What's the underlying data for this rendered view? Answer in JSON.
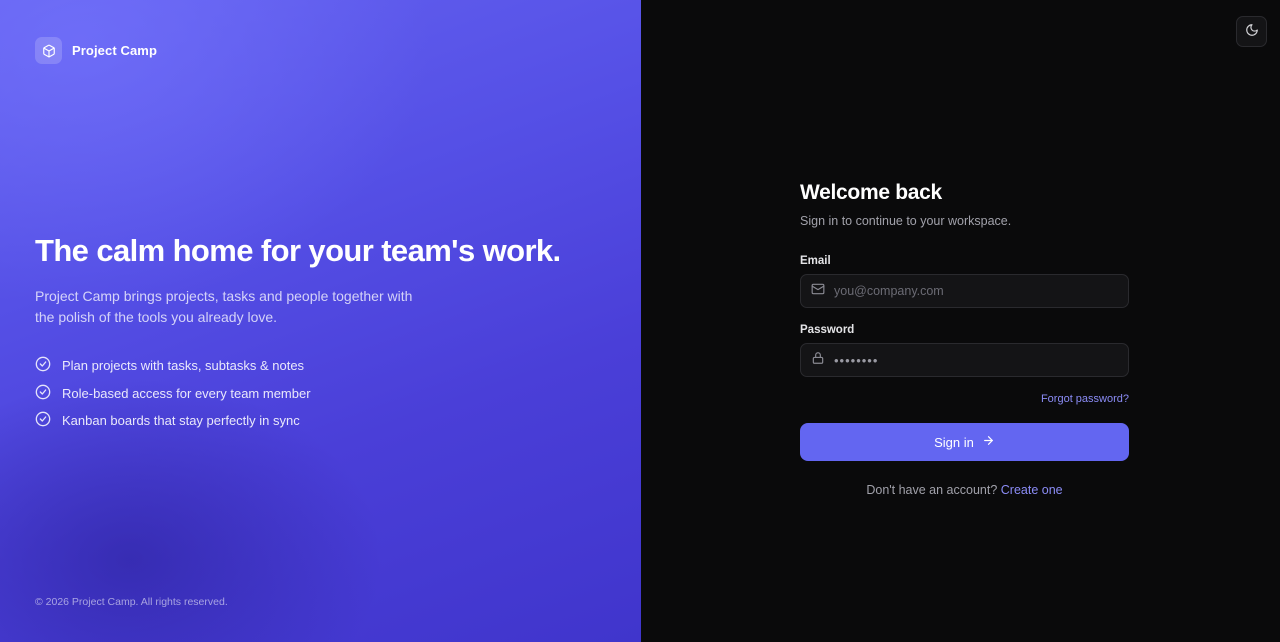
{
  "brand": {
    "name": "Project Camp",
    "icon": "box-icon"
  },
  "hero": {
    "headline": "The calm home for your team's work.",
    "tagline": "Project Camp brings projects, tasks and people together with the polish of the tools you already love.",
    "features": [
      {
        "icon": "check-circle-icon",
        "text": "Plan projects with tasks, subtasks & notes"
      },
      {
        "icon": "check-circle-icon",
        "text": "Role-based access for every team member"
      },
      {
        "icon": "check-circle-icon",
        "text": "Kanban boards that stay perfectly in sync"
      }
    ],
    "copyright": "© 2026 Project Camp. All rights reserved."
  },
  "theme_toggle": {
    "icon": "moon-icon"
  },
  "login": {
    "title": "Welcome back",
    "subtitle": "Sign in to continue to your workspace.",
    "email_label": "Email",
    "email_placeholder": "you@company.com",
    "email_value": "",
    "password_label": "Password",
    "password_value": "••••••••",
    "forgot_link": "Forgot password?",
    "submit_label": "Sign in",
    "signup_prompt": "Don't have an account?",
    "signup_link": "Create one"
  },
  "colors": {
    "accent": "#6366f1",
    "link": "#8b8cf6",
    "hero_gradient_start": "#6462f0",
    "hero_gradient_end": "#4035cc",
    "panel_background": "#0a0a0b"
  }
}
